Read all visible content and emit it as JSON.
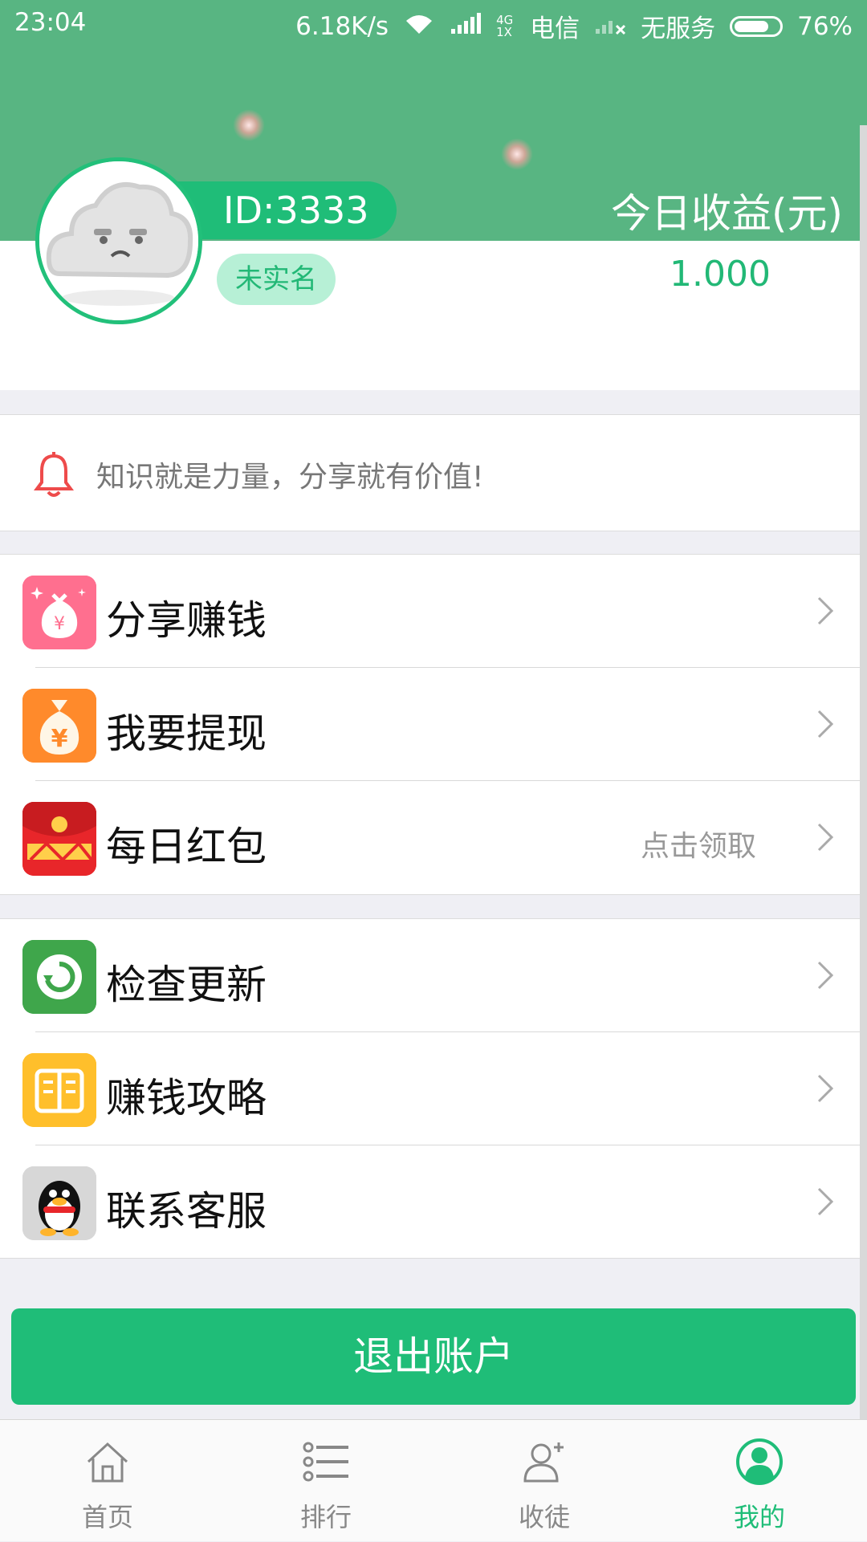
{
  "status_bar": {
    "time": "23:04",
    "speed": "6.18K/s",
    "network_tag": "4G 1X",
    "carrier": "电信",
    "no_service": "无服务",
    "battery": "76%"
  },
  "profile": {
    "id_text": "ID:3333",
    "verify_badge": "未实名",
    "earnings_label": "今日收益(元)",
    "earnings_value": "1.000"
  },
  "notice": {
    "text": "知识就是力量，分享就有价值!"
  },
  "menu_group_1": [
    {
      "label": "分享赚钱",
      "icon": "money-bag-sparkle-icon",
      "hint": ""
    },
    {
      "label": "我要提现",
      "icon": "money-bag-yen-icon",
      "hint": ""
    },
    {
      "label": "每日红包",
      "icon": "red-envelope-icon",
      "hint": "点击领取"
    }
  ],
  "menu_group_2": [
    {
      "label": "检查更新",
      "icon": "refresh-icon",
      "hint": ""
    },
    {
      "label": "赚钱攻略",
      "icon": "book-icon",
      "hint": ""
    },
    {
      "label": "联系客服",
      "icon": "qq-penguin-icon",
      "hint": ""
    }
  ],
  "logout_label": "退出账户",
  "tabs": [
    {
      "label": "首页",
      "icon": "home-icon",
      "active": false
    },
    {
      "label": "排行",
      "icon": "list-icon",
      "active": false
    },
    {
      "label": "收徒",
      "icon": "add-user-icon",
      "active": false
    },
    {
      "label": "我的",
      "icon": "profile-icon",
      "active": true
    }
  ],
  "colors": {
    "accent": "#1fbd78",
    "header": "#58b582",
    "background": "#efeff4"
  }
}
